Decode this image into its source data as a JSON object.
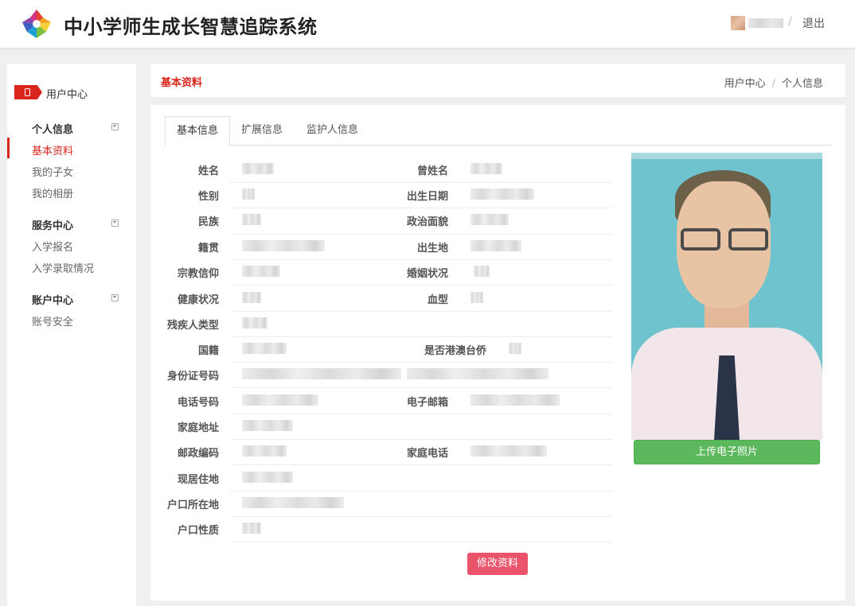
{
  "header": {
    "app_title": "中小学师生成长智慧追踪系统",
    "separator": "/",
    "logout_label": "退出"
  },
  "sidebar": {
    "user_center_label": "用户中心",
    "groups": [
      {
        "title": "个人信息",
        "items": [
          "基本资料",
          "我的子女",
          "我的相册"
        ]
      },
      {
        "title": "服务中心",
        "items": [
          "入学报名",
          "入学录取情况"
        ]
      },
      {
        "title": "账户中心",
        "items": [
          "账号安全"
        ]
      }
    ],
    "active_item": "基本资料"
  },
  "breadcrumb": {
    "page_title": "基本资料",
    "items": [
      "用户中心",
      "个人信息"
    ],
    "separator": "/"
  },
  "tabs": [
    "基本信息",
    "扩展信息",
    "监护人信息"
  ],
  "active_tab": "基本信息",
  "fields_left": [
    "姓名",
    "性别",
    "民族",
    "籍贯",
    "宗教信仰",
    "健康状况",
    "残疾人类型",
    "国籍",
    "身份证号码",
    "电话号码",
    "家庭地址",
    "邮政编码",
    "现居住地",
    "户口所在地",
    "户口性质"
  ],
  "fields_right": [
    "曾姓名",
    "出生日期",
    "政治面貌",
    "出生地",
    "婚姻状况",
    "血型",
    "是否港澳台侨",
    "电子邮箱",
    "家庭电话"
  ],
  "buttons": {
    "upload_photo": "上传电子照片",
    "edit_profile": "修改资料"
  },
  "colors": {
    "accent_red": "#d9251c",
    "upload_green": "#5cb85c",
    "edit_pink": "#e9546b"
  }
}
